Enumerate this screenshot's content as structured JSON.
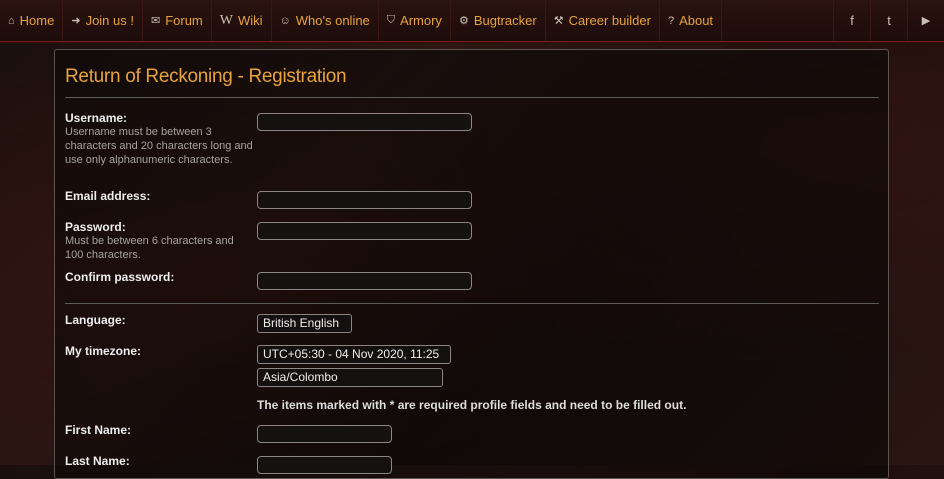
{
  "nav": {
    "items": [
      {
        "icon": "home-icon",
        "glyph": "⌂",
        "label": "Home"
      },
      {
        "icon": "sign-in-icon",
        "glyph": "➜",
        "label": "Join us !"
      },
      {
        "icon": "comments-icon",
        "glyph": "✉",
        "label": "Forum"
      },
      {
        "icon": "wikipedia-icon",
        "glyph": "W",
        "label": "Wiki"
      },
      {
        "icon": "users-icon",
        "glyph": "☺",
        "label": "Who's online"
      },
      {
        "icon": "shield-icon",
        "glyph": "⛉",
        "label": "Armory"
      },
      {
        "icon": "cog-icon",
        "glyph": "⚙",
        "label": "Bugtracker"
      },
      {
        "icon": "gavel-icon",
        "glyph": "⚒",
        "label": "Career builder"
      },
      {
        "icon": "question-icon",
        "glyph": "?",
        "label": "About"
      }
    ],
    "social": [
      {
        "icon": "facebook-icon",
        "glyph": "f"
      },
      {
        "icon": "twitter-icon",
        "glyph": "t"
      },
      {
        "icon": "youtube-icon",
        "glyph": "▶"
      }
    ]
  },
  "page": {
    "title": "Return of Reckoning - Registration"
  },
  "form": {
    "username_label": "Username:",
    "username_help": "Username must be between 3 characters and 20 characters long and use only alphanumeric characters.",
    "email_label": "Email address:",
    "password_label": "Password:",
    "password_help": "Must be between 6 characters and 100 characters.",
    "confirm_label": "Confirm password:",
    "language_label": "Language:",
    "language_value": "British English",
    "timezone_label": "My timezone:",
    "timezone_value": "UTC+05:30 - 04 Nov 2020, 11:25",
    "timezone_zone_value": "Asia/Colombo",
    "required_note": "The items marked with * are required profile fields and need to be filled out.",
    "first_name_label": "First Name:",
    "last_name_label": "Last Name:"
  },
  "colors": {
    "accent": "#e7a33d",
    "nav_border": "#6e1e17"
  }
}
